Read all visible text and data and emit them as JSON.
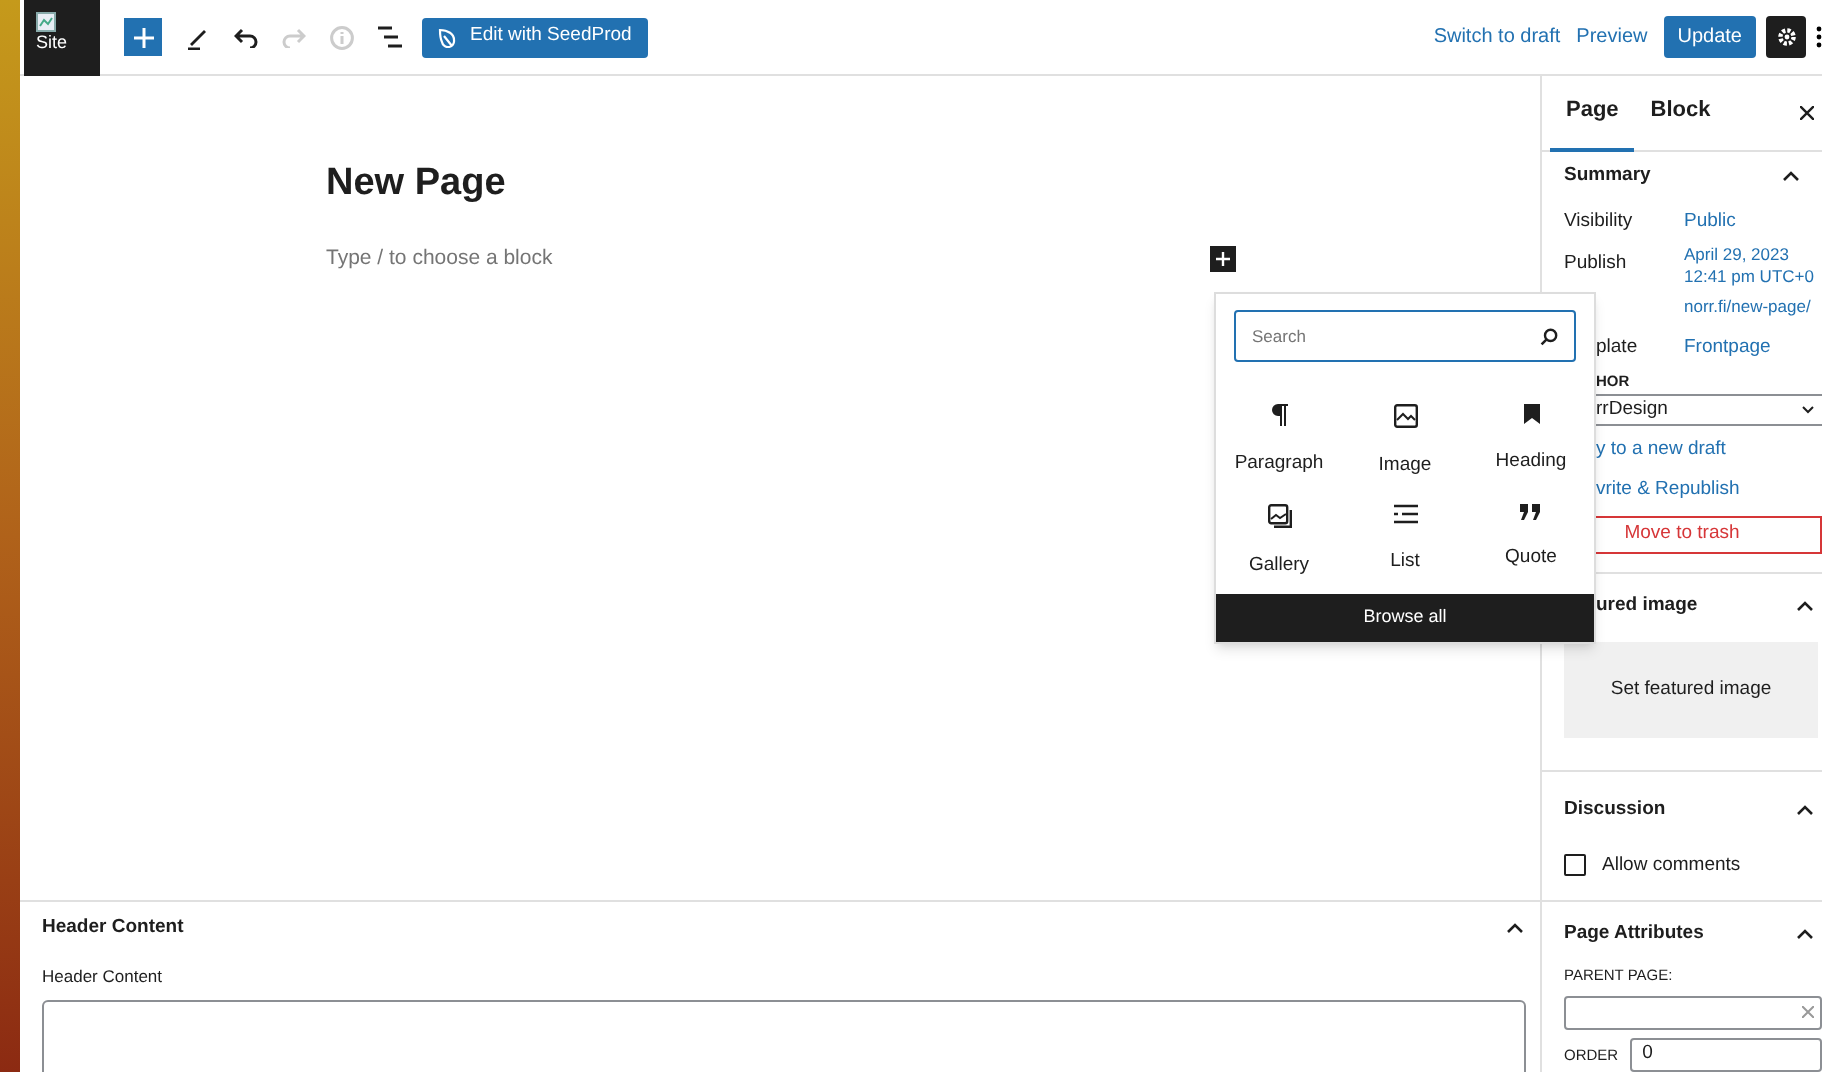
{
  "toolbar": {
    "site_label": "Site",
    "tools": [
      {
        "kind": "add",
        "disabled": false
      },
      {
        "kind": "edit",
        "disabled": false
      },
      {
        "kind": "undo",
        "disabled": false
      },
      {
        "kind": "redo",
        "disabled": true
      },
      {
        "kind": "info",
        "disabled": true
      },
      {
        "kind": "outline",
        "disabled": false
      }
    ],
    "seedprod_button": "Edit with SeedProd",
    "switch_to_draft": "Switch to draft",
    "preview": "Preview",
    "update": "Update"
  },
  "editor": {
    "title": "New Page",
    "block_placeholder": "Type / to choose a block"
  },
  "inserter": {
    "search_placeholder": "Search",
    "blocks": [
      {
        "kind": "paragraph",
        "label": "Paragraph"
      },
      {
        "kind": "image",
        "label": "Image"
      },
      {
        "kind": "heading",
        "label": "Heading"
      },
      {
        "kind": "gallery",
        "label": "Gallery"
      },
      {
        "kind": "list",
        "label": "List"
      },
      {
        "kind": "quote",
        "label": "Quote"
      }
    ],
    "browse_all": "Browse all"
  },
  "sidebar": {
    "tabs": [
      {
        "label": "Page",
        "selected": true
      },
      {
        "label": "Block",
        "selected": false
      }
    ],
    "summary": {
      "title": "Summary",
      "expanded": true,
      "visibility_label": "Visibility",
      "visibility": "Public",
      "publish_label": "Publish",
      "publish": "April 29, 2023 12:41 pm UTC+0",
      "url": "norr.fi/new-page/",
      "template_label": "plate",
      "template": "Frontpage",
      "author_label": "HOR",
      "author": "rrDesign",
      "copy_link": "y to a new draft",
      "rewrite_link": "vrite & Republish",
      "trash": "Move to trash"
    },
    "featured": {
      "title": "ured image",
      "expanded": true,
      "button": "Set featured image"
    },
    "discussion": {
      "title": "Discussion",
      "expanded": true,
      "allow_comments": {
        "label": "Allow comments",
        "checked": false
      }
    },
    "attributes": {
      "title": "Page Attributes",
      "expanded": true,
      "parent_label": "PARENT PAGE:",
      "order_label": "ORDER",
      "order": "0"
    }
  },
  "meta_box": {
    "title": "Header Content",
    "expanded": true,
    "field_label": "Header Content"
  }
}
